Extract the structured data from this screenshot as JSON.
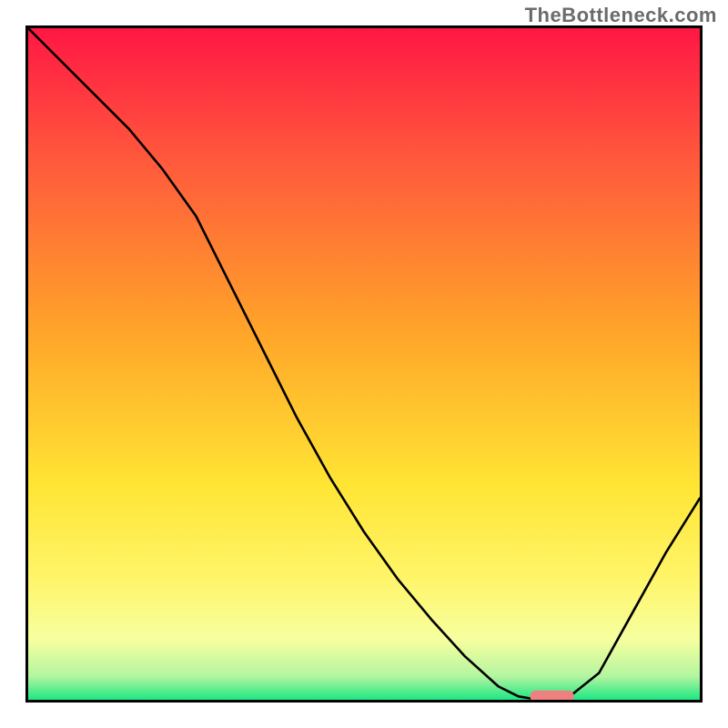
{
  "watermark": "TheBottleneck.com",
  "chart_data": {
    "type": "line",
    "title": "",
    "xlabel": "",
    "ylabel": "",
    "xlim": [
      0,
      100
    ],
    "ylim": [
      0,
      100
    ],
    "x": [
      0,
      5,
      10,
      15,
      20,
      25,
      30,
      35,
      40,
      45,
      50,
      55,
      60,
      65,
      70,
      73,
      76,
      80,
      85,
      90,
      95,
      100
    ],
    "values": [
      100,
      95,
      90,
      85,
      79,
      72,
      62,
      52,
      42,
      33,
      25,
      18,
      12,
      6.5,
      2,
      0.5,
      0,
      0,
      4,
      13,
      22,
      30
    ],
    "marker": {
      "x": 78,
      "y": 0.5,
      "color": "#f08080",
      "shape": "pill"
    },
    "gradient_stops": [
      {
        "offset": 0.0,
        "color": "#ff1744"
      },
      {
        "offset": 0.2,
        "color": "#ff5a3c"
      },
      {
        "offset": 0.45,
        "color": "#ffa429"
      },
      {
        "offset": 0.68,
        "color": "#ffe534"
      },
      {
        "offset": 0.82,
        "color": "#fff56a"
      },
      {
        "offset": 0.91,
        "color": "#f6ff9f"
      },
      {
        "offset": 0.965,
        "color": "#b4f5a0"
      },
      {
        "offset": 1.0,
        "color": "#1ce783"
      }
    ]
  }
}
